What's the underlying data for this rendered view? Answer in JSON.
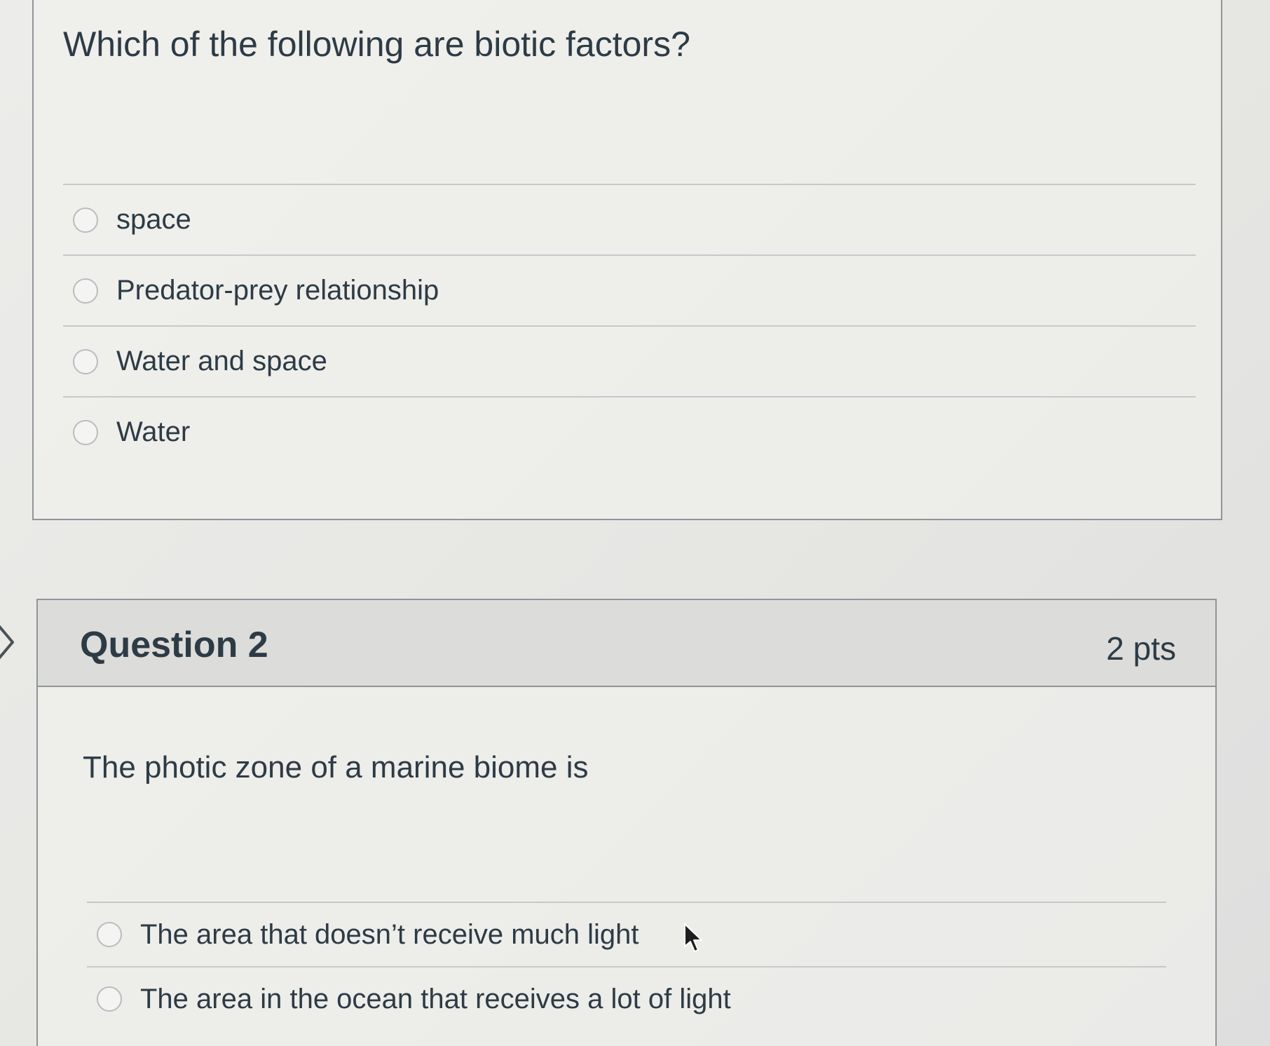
{
  "question1": {
    "text": "Which of the following are biotic factors?",
    "answers": [
      {
        "label": "space"
      },
      {
        "label": "Predator-prey relationship"
      },
      {
        "label": "Water and space"
      },
      {
        "label": "Water"
      }
    ]
  },
  "question2": {
    "title": "Question 2",
    "points": "2 pts",
    "text": "The photic zone of a marine biome is",
    "answers": [
      {
        "label": "The area that doesn’t receive much light"
      },
      {
        "label": "The area in the ocean that receives a lot of light"
      }
    ]
  },
  "icons": {
    "side_arrow": "chevron-right-icon",
    "cursor": "mouse-pointer-icon",
    "radio": "radio-button"
  }
}
